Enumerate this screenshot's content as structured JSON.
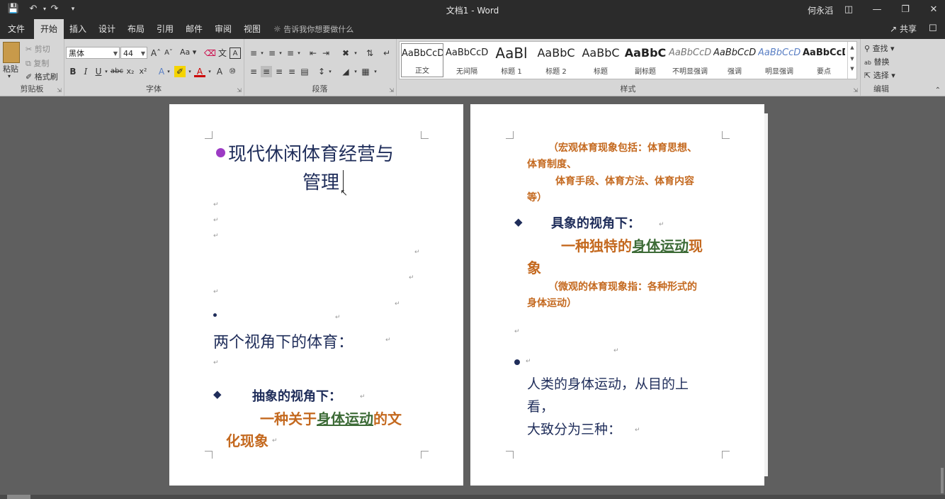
{
  "window": {
    "title": "文档1 - Word",
    "user": "何永滔"
  },
  "tabs": [
    "文件",
    "开始",
    "插入",
    "设计",
    "布局",
    "引用",
    "邮件",
    "审阅",
    "视图"
  ],
  "active_tab": "开始",
  "tell_me": "告诉我你想要做什么",
  "share": "共享",
  "ribbon": {
    "clipboard": {
      "label": "剪贴板",
      "paste": "粘贴",
      "cut": "剪切",
      "copy": "复制",
      "format_painter": "格式刷"
    },
    "font": {
      "label": "字体",
      "font_name": "黑体",
      "font_size": "44",
      "change_case": "Aa"
    },
    "paragraph": {
      "label": "段落"
    },
    "styles": {
      "label": "样式",
      "items": [
        {
          "sample": "AaBbCcDc",
          "name": "正文"
        },
        {
          "sample": "AaBbCcDc",
          "name": "无间隔"
        },
        {
          "sample": "AaBl",
          "name": "标题 1"
        },
        {
          "sample": "AaBbC",
          "name": "标题 2"
        },
        {
          "sample": "AaBbC",
          "name": "标题"
        },
        {
          "sample": "AaBbC",
          "name": "副标题"
        },
        {
          "sample": "AaBbCcDc",
          "name": "不明显强调"
        },
        {
          "sample": "AaBbCcDc",
          "name": "强调"
        },
        {
          "sample": "AaBbCcDc",
          "name": "明显强调"
        },
        {
          "sample": "AaBbCcD",
          "name": "要点"
        }
      ]
    },
    "editing": {
      "label": "编辑",
      "find": "查找",
      "replace": "替换",
      "select": "选择"
    }
  },
  "page1": {
    "title_line1": "现代休闲体育经营与",
    "title_line2": "管理",
    "heading": "两个视角下的体育：",
    "sub_heading": "抽象的视角下：",
    "desc_pre": "一种关于",
    "desc_link": "身体运动",
    "desc_post": "的文",
    "desc_line2": "化现象"
  },
  "page2": {
    "note1_line1": "（宏观体育现象包括：体育思想、",
    "note1_line2": "体育制度、",
    "note1_line3": "体育手段、体育方法、体育内容",
    "note1_line4": "等）",
    "sub_heading": "具象的视角下：",
    "desc_pre": "一种独特的",
    "desc_link": "身体运动",
    "desc_post": "现",
    "desc_line2": "象",
    "note2_line1": "（微观的体育现象指：各种形式的",
    "note2_line2": "身体运动）",
    "body_line1": "人类的身体运动，从目的上",
    "body_line2": "看，",
    "body_line3": "大致分为三种："
  },
  "colors": {
    "title_bullet": "#9c3bc4",
    "navy": "#1f2d5a",
    "orange": "#c4691f",
    "green": "#3d6b37"
  }
}
